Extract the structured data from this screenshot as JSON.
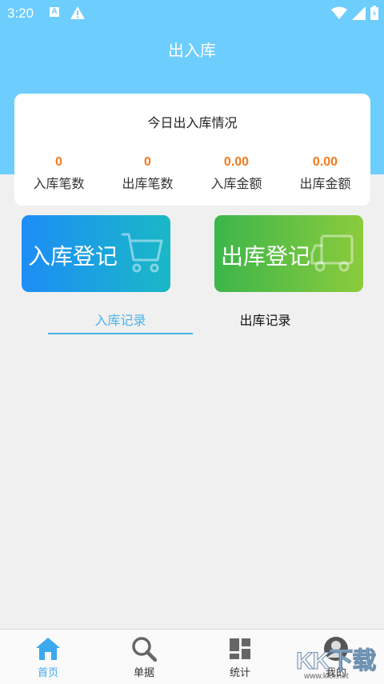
{
  "status": {
    "time": "3:20",
    "a_badge": "A"
  },
  "header": {
    "title": "出入库"
  },
  "summary": {
    "title": "今日出入库情况",
    "stats": [
      {
        "value": "0",
        "label": "入库笔数"
      },
      {
        "value": "0",
        "label": "出库笔数"
      },
      {
        "value": "0.00",
        "label": "入库金额"
      },
      {
        "value": "0.00",
        "label": "出库金额"
      }
    ]
  },
  "actions": {
    "inbound": "入库登记",
    "outbound": "出库登记"
  },
  "tabs": {
    "inbound_records": "入库记录",
    "outbound_records": "出库记录"
  },
  "nav": [
    {
      "label": "首页",
      "icon": "home-icon"
    },
    {
      "label": "单据",
      "icon": "search-icon"
    },
    {
      "label": "统计",
      "icon": "stats-icon"
    },
    {
      "label": "我的",
      "icon": "profile-icon"
    }
  ],
  "watermark": {
    "brand": "KK下载",
    "url": "www.kkx.net"
  },
  "colors": {
    "header": "#6dcdfd",
    "accent_orange": "#f07a1d",
    "tab_active": "#4ab3e8"
  }
}
